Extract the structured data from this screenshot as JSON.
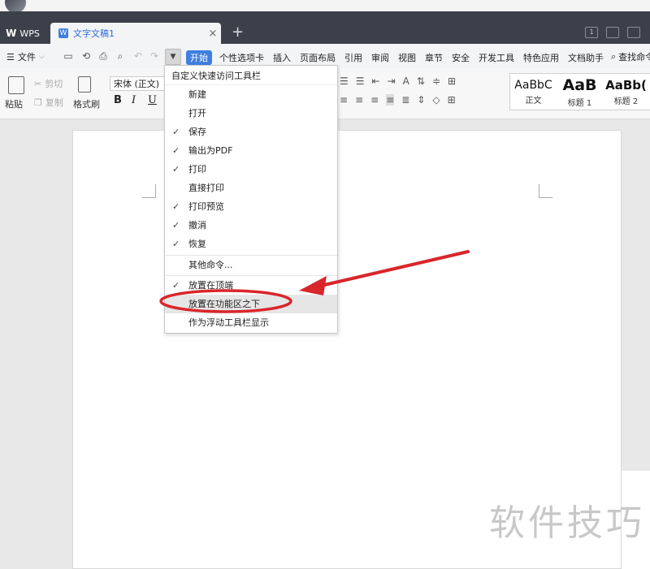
{
  "app": {
    "wps_tab_label": "WPS",
    "doc_tab_label": "文字文稿1",
    "doc_tab_close": "×",
    "new_tab_label": "+"
  },
  "menubar": {
    "file_label": "文件",
    "start_tab": "开始",
    "tabs": [
      "个性选项卡",
      "插入",
      "页面布局",
      "引用",
      "审阅",
      "视图",
      "章节",
      "安全",
      "开发工具",
      "特色应用",
      "文档助手"
    ],
    "search_label": "查找命令"
  },
  "ribbon": {
    "paste_label": "粘贴",
    "cut_label": "剪切",
    "copy_label": "复制",
    "format_painter_label": "格式刷",
    "font_name": "宋体 (正文)",
    "bold": "B",
    "italic": "I",
    "underline": "U",
    "styles": [
      {
        "sample": "AaBbC",
        "name": "正文"
      },
      {
        "sample": "AaB",
        "name": "标题 1"
      },
      {
        "sample": "AaBb(",
        "name": "标题 2"
      }
    ]
  },
  "dropdown": {
    "title": "自定义快速访问工具栏",
    "items": [
      {
        "label": "新建",
        "checked": false
      },
      {
        "label": "打开",
        "checked": false
      },
      {
        "label": "保存",
        "checked": true
      },
      {
        "label": "输出为PDF",
        "checked": true
      },
      {
        "label": "打印",
        "checked": true
      },
      {
        "label": "直接打印",
        "checked": false
      },
      {
        "label": "打印预览",
        "checked": true
      },
      {
        "label": "撤消",
        "checked": true
      },
      {
        "label": "恢复",
        "checked": true
      }
    ],
    "more_commands": "其他命令...",
    "position_items": [
      {
        "label": "放置在顶端",
        "checked": true
      },
      {
        "label": "放置在功能区之下",
        "checked": false,
        "highlighted": true
      },
      {
        "label": "作为浮动工具栏显示",
        "checked": false
      }
    ],
    "check_mark": "✓"
  },
  "annotation": {
    "color": "#d9262b"
  },
  "watermark": "软件技巧",
  "colors": {
    "accent": "#3f7fe0",
    "titlebar": "#3b404a"
  }
}
